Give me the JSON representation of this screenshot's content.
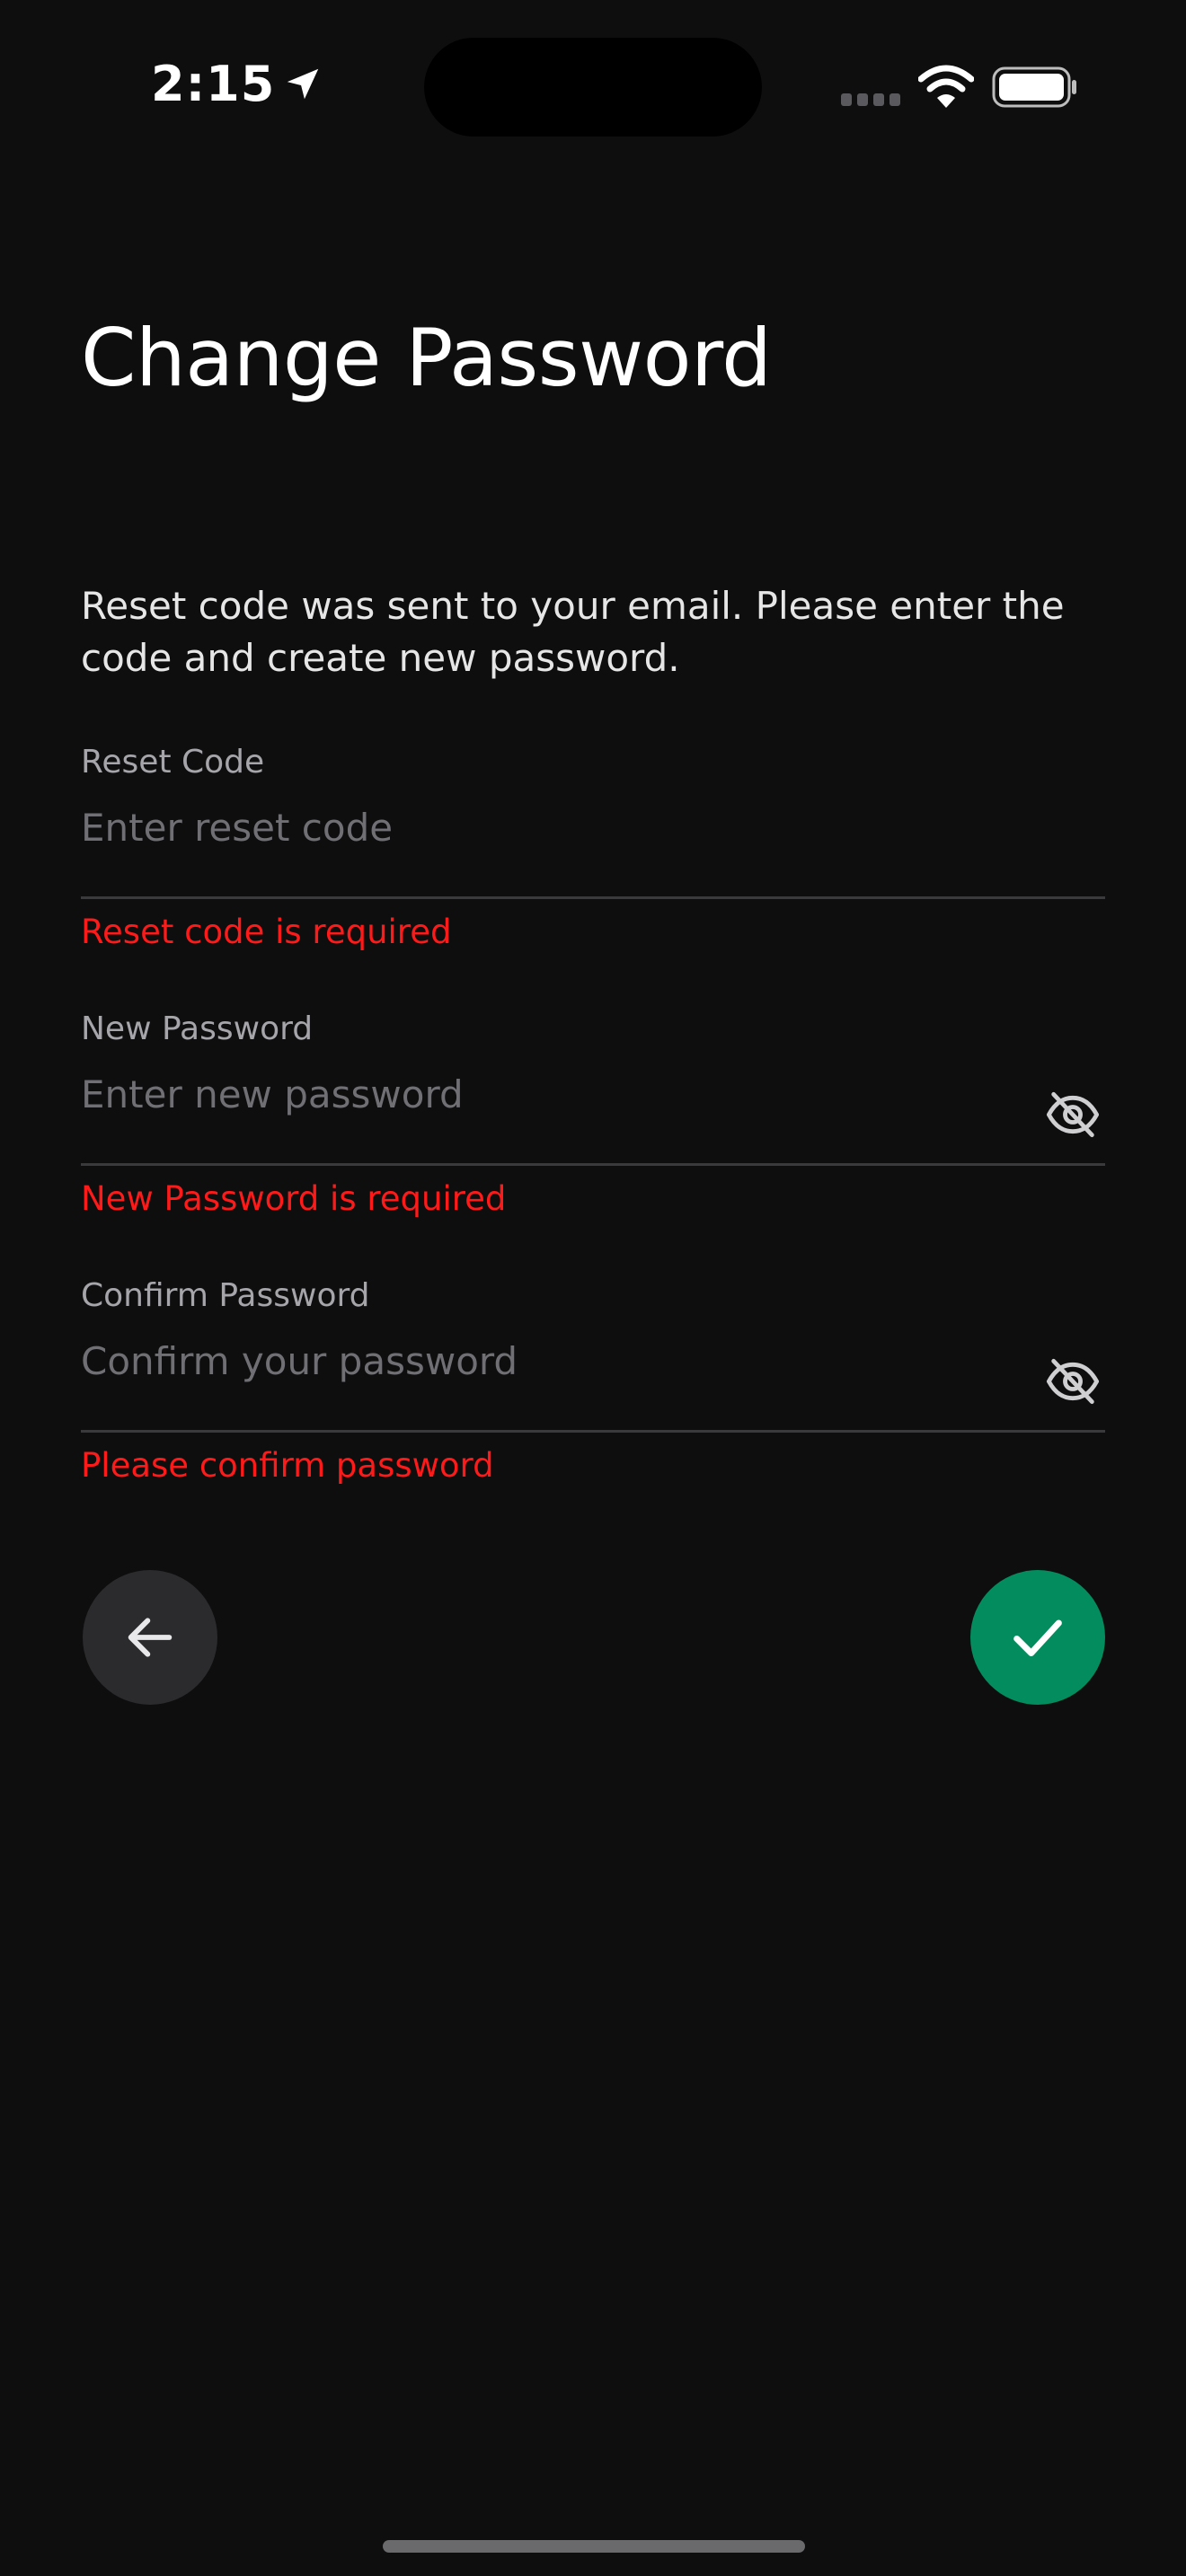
{
  "status_bar": {
    "time": "2:15",
    "location_icon": "location-arrow-icon",
    "signal_icon": "cellular-signal-icon",
    "wifi_icon": "wifi-icon",
    "battery_icon": "battery-full-icon"
  },
  "page": {
    "title": "Change Password",
    "description": "Reset code was sent to your email. Please enter the code and create new password."
  },
  "fields": {
    "reset_code": {
      "label": "Reset Code",
      "placeholder": "Enter reset code",
      "value": "",
      "error": "Reset code is required"
    },
    "new_password": {
      "label": "New Password",
      "placeholder": "Enter new password",
      "value": "",
      "error": "New Password is required",
      "toggle_icon": "eye-off-icon"
    },
    "confirm_password": {
      "label": "Confirm Password",
      "placeholder": "Confirm your password",
      "value": "",
      "error": "Please confirm password",
      "toggle_icon": "eye-off-icon"
    }
  },
  "actions": {
    "back_icon": "arrow-left-icon",
    "confirm_icon": "checkmark-icon"
  },
  "colors": {
    "background": "#0e0e0f",
    "error": "#ff1a1a",
    "confirm_button": "#038c5e",
    "back_button": "#2b2b2e",
    "label": "#a5a5aa",
    "placeholder": "#6f6f74"
  }
}
